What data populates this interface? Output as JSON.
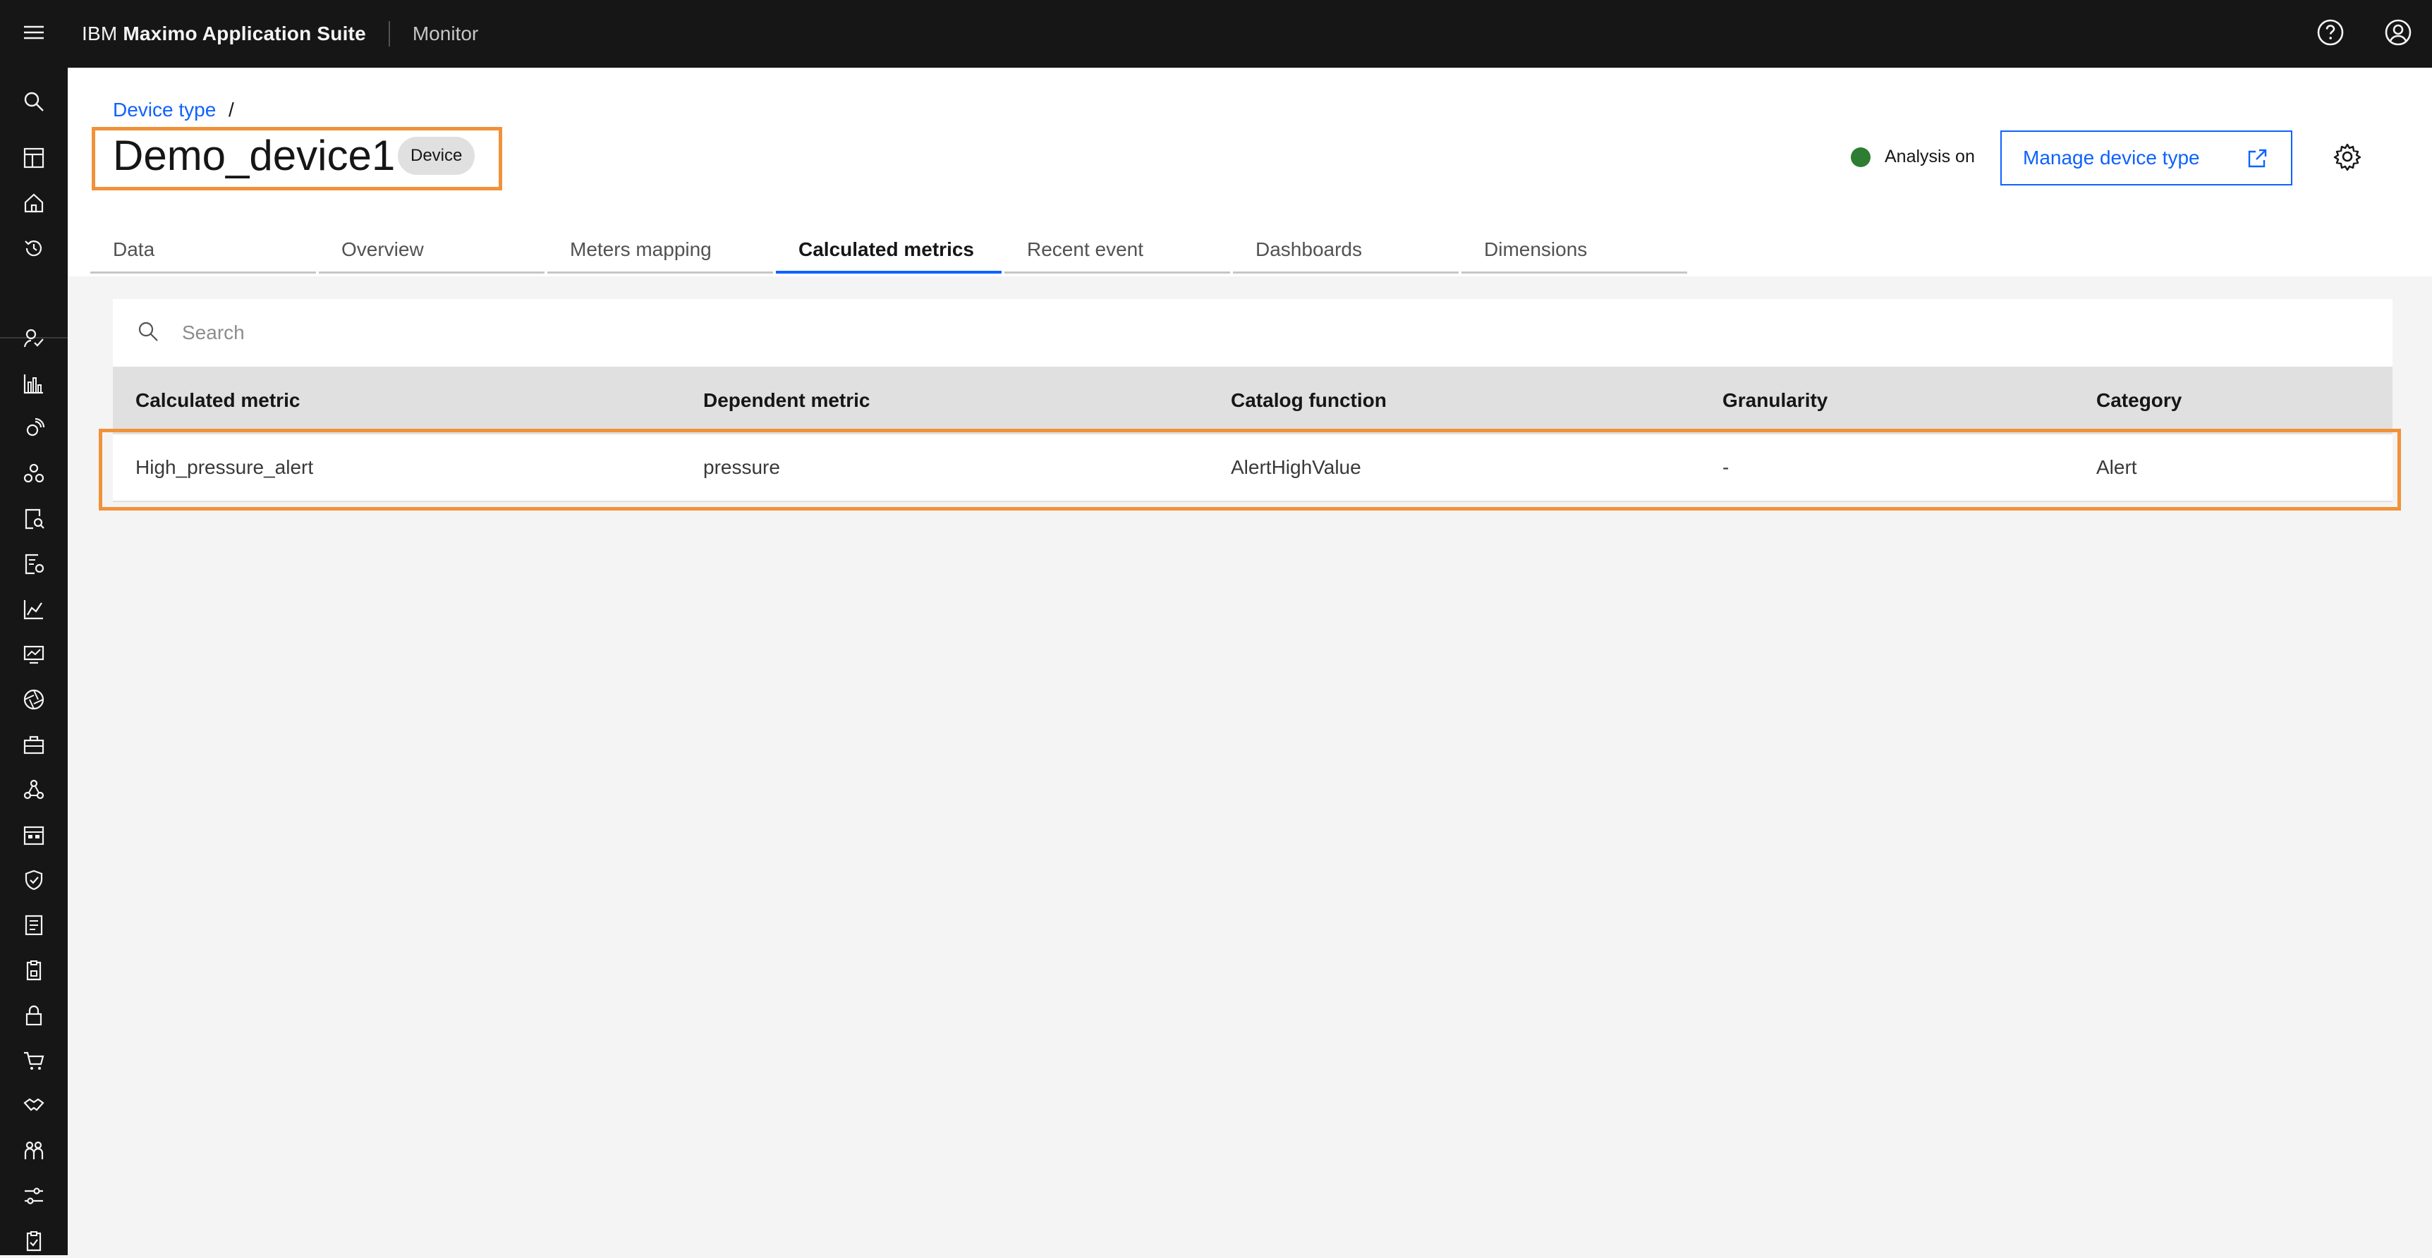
{
  "header": {
    "brand_prefix": "IBM",
    "brand_name": "Maximo Application Suite",
    "app_name": "Monitor",
    "icons": [
      "menu-icon",
      "help-icon",
      "user-avatar-icon"
    ]
  },
  "sidenav": {
    "icons": [
      "search-icon",
      "dashboard-icon",
      "home-icon",
      "history-icon",
      "user-check-icon",
      "bar-chart-icon",
      "satellite-icon",
      "network-icon",
      "document-search-icon",
      "report-icon",
      "line-chart-icon",
      "monitor-chart-icon",
      "aperture-icon",
      "toolbox-icon",
      "molecule-icon",
      "calendar-grid-icon",
      "shield-icon",
      "ledger-icon",
      "clipboard-lock-icon",
      "lock-icon",
      "cart-icon",
      "handshake-icon",
      "people-icon",
      "sliders-icon",
      "clipboard-check-icon"
    ]
  },
  "page": {
    "breadcrumb": "Device type",
    "breadcrumb_sep": "/",
    "title": "Demo_device1",
    "tag": "Device",
    "status_label": "Analysis on",
    "status_color": "#2e7d32",
    "manage_button": "Manage device type",
    "accent": "#0f62fe",
    "highlight": "#f1923a"
  },
  "tabs": [
    {
      "label": "Data"
    },
    {
      "label": "Overview"
    },
    {
      "label": "Meters mapping"
    },
    {
      "label": "Calculated metrics",
      "active": true
    },
    {
      "label": "Recent event"
    },
    {
      "label": "Dashboards"
    },
    {
      "label": "Dimensions"
    }
  ],
  "table": {
    "search_placeholder": "Search",
    "columns": [
      "Calculated metric",
      "Dependent metric",
      "Catalog function",
      "Granularity",
      "Category"
    ],
    "rows": [
      [
        "High_pressure_alert",
        "pressure",
        "AlertHighValue",
        "-",
        "Alert"
      ]
    ]
  }
}
